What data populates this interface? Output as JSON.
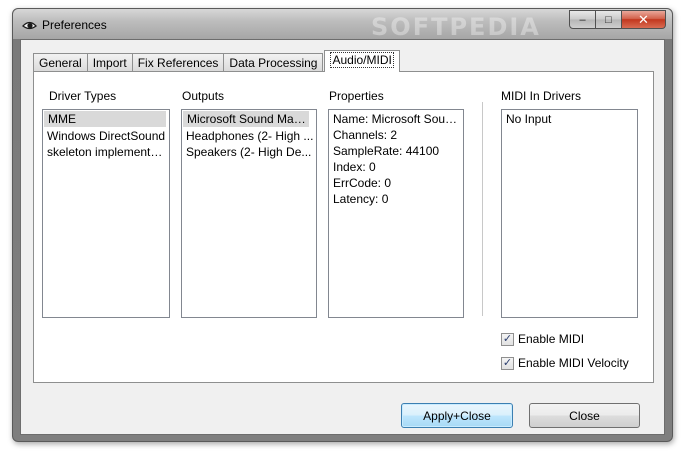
{
  "window": {
    "title": "Preferences",
    "watermark": "SOFTPEDIA",
    "controls": {
      "minimize": "–",
      "maximize": "□",
      "close": "✕"
    }
  },
  "tabs": [
    {
      "label": "General"
    },
    {
      "label": "Import"
    },
    {
      "label": "Fix References"
    },
    {
      "label": "Data Processing"
    },
    {
      "label": "Audio/MIDI",
      "active": true
    }
  ],
  "driver_types": {
    "label": "Driver Types",
    "items": [
      "MME",
      "Windows DirectSound",
      "skeleton implementation"
    ],
    "selected_index": 0
  },
  "outputs": {
    "label": "Outputs",
    "items": [
      "Microsoft Sound Mapp...",
      "Headphones (2- High ...",
      "Speakers (2- High De..."
    ],
    "selected_index": 0
  },
  "properties": {
    "label": "Properties",
    "items": [
      "Name: Microsoft Sound ...",
      "Channels: 2",
      "SampleRate: 44100",
      "Index: 0",
      "ErrCode: 0",
      "Latency: 0"
    ]
  },
  "midi_in_drivers": {
    "label": "MIDI In Drivers",
    "items": [
      "No Input"
    ]
  },
  "options": {
    "enable_midi": {
      "label": "Enable MIDI",
      "checked": true
    },
    "enable_midi_velocity": {
      "label": "Enable MIDI Velocity",
      "checked": true
    }
  },
  "buttons": {
    "apply_close": "Apply+Close",
    "close": "Close"
  },
  "icons": {
    "app": "eye-icon",
    "checkmark": "✓"
  }
}
